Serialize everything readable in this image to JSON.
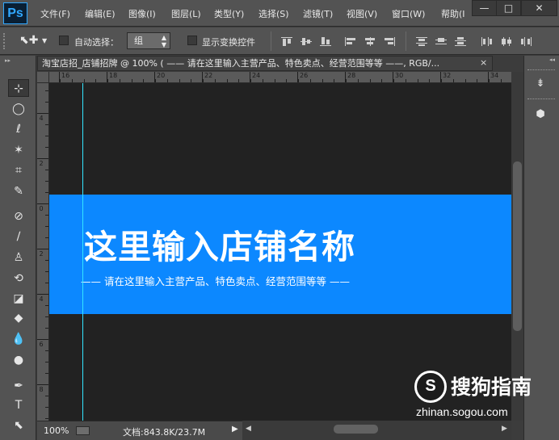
{
  "app": {
    "logo": "Ps",
    "menu": [
      "文件(F)",
      "编辑(E)",
      "图像(I)",
      "图层(L)",
      "类型(Y)",
      "选择(S)",
      "滤镜(T)",
      "视图(V)",
      "窗口(W)",
      "帮助(I"
    ],
    "window_buttons": {
      "minimize": "—",
      "restore": "□",
      "close": "✕"
    }
  },
  "options": {
    "auto_select_label": "自动选择：",
    "auto_select_checked": false,
    "layer_mode": "组",
    "show_transform_label": "显示变换控件",
    "show_transform_checked": false
  },
  "document": {
    "tab_title": "淘宝店招_店铺招牌 @ 100% ( —— 请在这里输入主营产品、特色卖点、经营范围等等 ——, RGB/...",
    "close": "×",
    "h_ruler_labels": [
      "16",
      "18",
      "20",
      "22",
      "24",
      "26",
      "28",
      "30",
      "32",
      "34"
    ],
    "v_ruler_labels": [
      "4",
      "2",
      "0",
      "2",
      "4",
      "6",
      "8"
    ]
  },
  "canvas": {
    "shop_name": "这里输入店铺名称",
    "tagline": "—— 请在这里输入主营产品、特色卖点、经营范围等等 ——",
    "banner_color": "#0c88ff",
    "guide_color": "#33e6ff"
  },
  "status": {
    "zoom": "100%",
    "doc_size": "文档:843.8K/23.7M",
    "arrow": "▶"
  },
  "tools": [
    "move-icon",
    "ellipse-marquee-icon",
    "lasso-icon",
    "magic-wand-icon",
    "crop-icon",
    "eyedropper-icon",
    "healing-brush-icon",
    "brush-icon",
    "clone-stamp-icon",
    "history-brush-icon",
    "eraser-icon",
    "paint-bucket-icon",
    "blur-icon",
    "dodge-icon",
    "pen-icon",
    "type-icon",
    "path-selection-icon"
  ],
  "tool_glyphs": [
    "⊹",
    "◯",
    "ℓ",
    "✶",
    "⌗",
    "✎",
    "⊘",
    "∕",
    "♙",
    "⟲",
    "◪",
    "◆",
    "💧",
    "●",
    "✒",
    "T",
    "⬉"
  ],
  "watermark": {
    "logo_letter": "S",
    "name": "搜狗指南",
    "url": "zhinan.sogou.com"
  }
}
